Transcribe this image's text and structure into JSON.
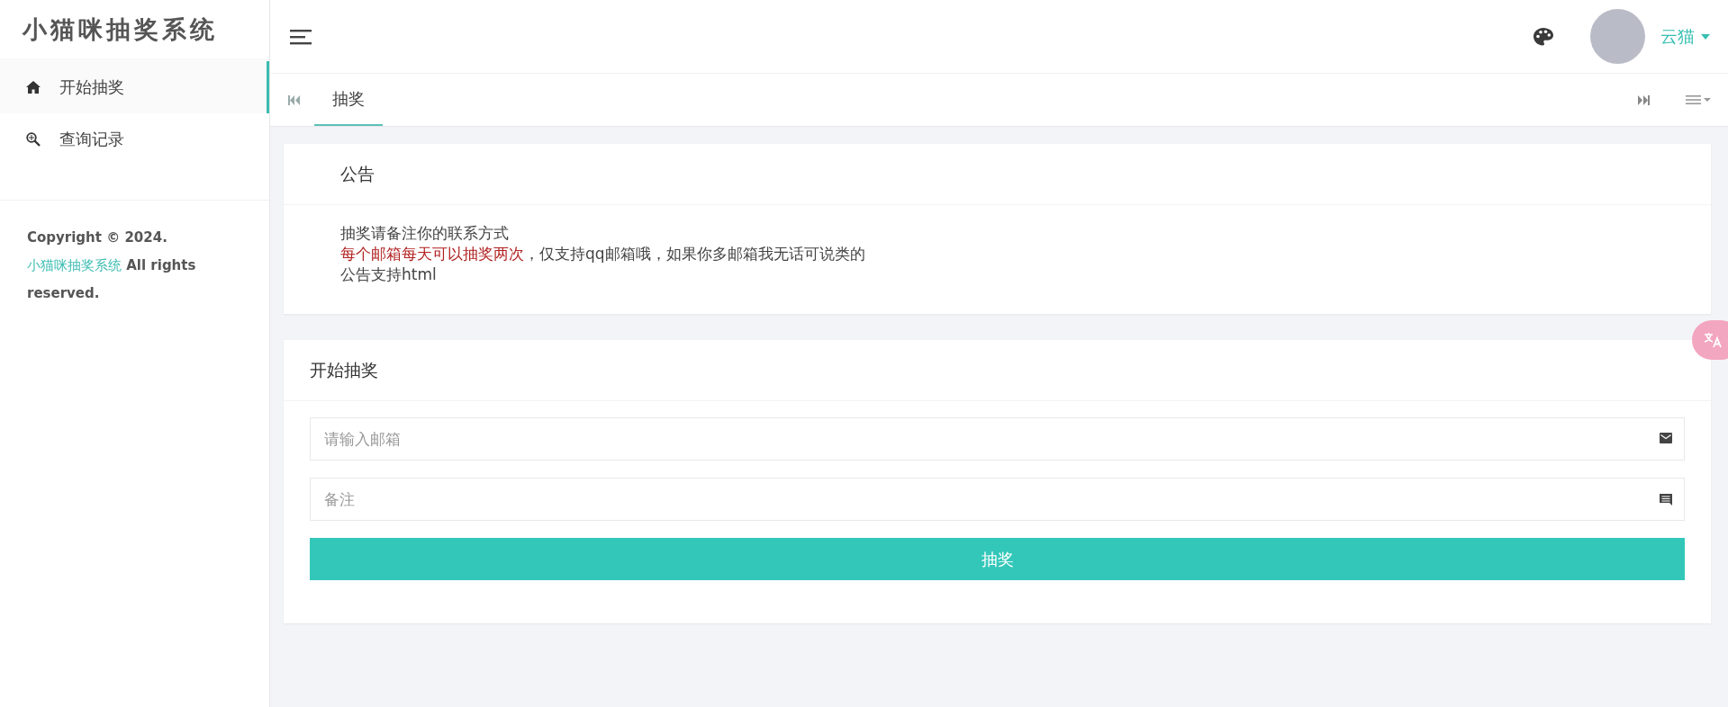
{
  "sidebar": {
    "logo": "小猫咪抽奖系统",
    "items": [
      {
        "label": "开始抽奖",
        "selected": true
      },
      {
        "label": "查询记录",
        "selected": false
      }
    ],
    "footer": {
      "prefix": "Copyright © 2024. ",
      "link": "小猫咪抽奖系统",
      "suffix": " All rights reserved."
    }
  },
  "header": {
    "username": "云猫"
  },
  "tabs": [
    {
      "label": "抽奖",
      "selected": true
    }
  ],
  "notice": {
    "title": "公告",
    "lines": [
      [
        {
          "text": "抽奖请备注你的联系方式",
          "highlight": false
        }
      ],
      [
        {
          "text": "每个邮箱每天可以抽奖两次",
          "highlight": true
        },
        {
          "text": "，仅支持qq邮箱哦，如果你多邮箱我无话可说类的",
          "highlight": false
        }
      ],
      [
        {
          "text": "公告支持html",
          "highlight": false
        }
      ]
    ]
  },
  "draw_form": {
    "title": "开始抽奖",
    "fields": [
      {
        "placeholder": "请输入邮箱"
      },
      {
        "placeholder": "备注"
      }
    ],
    "button": "抽奖"
  }
}
